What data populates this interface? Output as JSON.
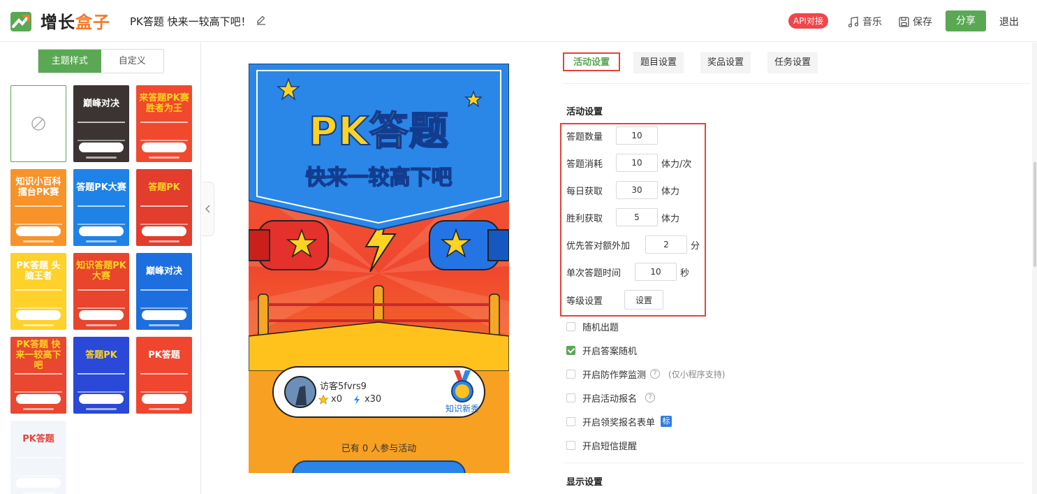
{
  "header": {
    "logo_main": "增长",
    "logo_accent": "盒子",
    "page_name": "PK答题 快来一较高下吧！",
    "api_badge": "API对接",
    "music_label": "音乐",
    "save_label": "保存",
    "share_label": "分享",
    "exit_label": "退出"
  },
  "left_tabs": {
    "theme": "主题样式",
    "custom": "自定义"
  },
  "themes": [
    {
      "id": "none",
      "banner": ""
    },
    {
      "banner": "巅峰对决",
      "bg": "#3b3432",
      "fg": "#ffffff"
    },
    {
      "banner": "来答题PK赛 胜者为王",
      "bg": "#f1492d",
      "fg": "#ffd321"
    },
    {
      "banner": "知识小百科 擂台PK赛",
      "bg": "#f8932a",
      "fg": "#ffffff"
    },
    {
      "banner": "答题PK大赛",
      "bg": "#1f82e6",
      "fg": "#ffffff"
    },
    {
      "banner": "答题PK",
      "bg": "#e23d2d",
      "fg": "#ffd321"
    },
    {
      "banner": "PK答题 头脑王者",
      "bg": "#ffd12a",
      "fg": "#ffffff"
    },
    {
      "banner": "知识答题PK大赛",
      "bg": "#e8452c",
      "fg": "#ffd321"
    },
    {
      "banner": "巅峰对决",
      "bg": "#1d6fe0",
      "fg": "#ffffff"
    },
    {
      "banner": "PK答题 快来一较高下吧",
      "bg": "#e9472f",
      "fg": "#ffd321"
    },
    {
      "banner": "答题PK",
      "bg": "#2a49d8",
      "fg": "#ffd321"
    },
    {
      "banner": "PK答题",
      "bg": "#f0452f",
      "fg": "#ffffff"
    },
    {
      "banner": "PK答题",
      "bg": "#f2f6fb",
      "fg": "#e5433b"
    }
  ],
  "preview": {
    "title": "PK答题",
    "subtitle": "快来一较高下吧",
    "player_name": "访客5fvrs9",
    "stars": "x0",
    "energy": "x30",
    "medal_label": "知识新秀",
    "participants": "已有 0 人参与活动"
  },
  "right_tabs": [
    "活动设置",
    "题目设置",
    "奖品设置",
    "任务设置"
  ],
  "activity": {
    "section_title": "活动设置",
    "rows": [
      {
        "label": "答题数量",
        "value": "10",
        "unit": ""
      },
      {
        "label": "答题消耗",
        "value": "10",
        "unit": "体力/次"
      },
      {
        "label": "每日获取",
        "value": "30",
        "unit": "体力"
      },
      {
        "label": "胜利获取",
        "value": "5",
        "unit": "体力"
      },
      {
        "label": "优先答对额外加",
        "value": "2",
        "unit": "分"
      },
      {
        "label": "单次答题时间",
        "value": "10",
        "unit": "秒"
      }
    ],
    "level_label": "等级设置",
    "level_button": "设置",
    "checks": [
      {
        "label": "随机出题",
        "checked": false
      },
      {
        "label": "开启答案随机",
        "checked": true
      },
      {
        "label": "开启防作弊监测",
        "checked": false,
        "help": "?",
        "note": "(仅小程序支持)"
      },
      {
        "label": "开启活动报名",
        "checked": false,
        "help": "?"
      },
      {
        "label": "开启领奖报名表单",
        "checked": false,
        "tag": "标"
      },
      {
        "label": "开启短信提醒",
        "checked": false
      }
    ],
    "display_title": "显示设置"
  },
  "colors": {
    "accent": "#5aa853",
    "highlight": "#e5433b",
    "api": "#f0464b"
  }
}
